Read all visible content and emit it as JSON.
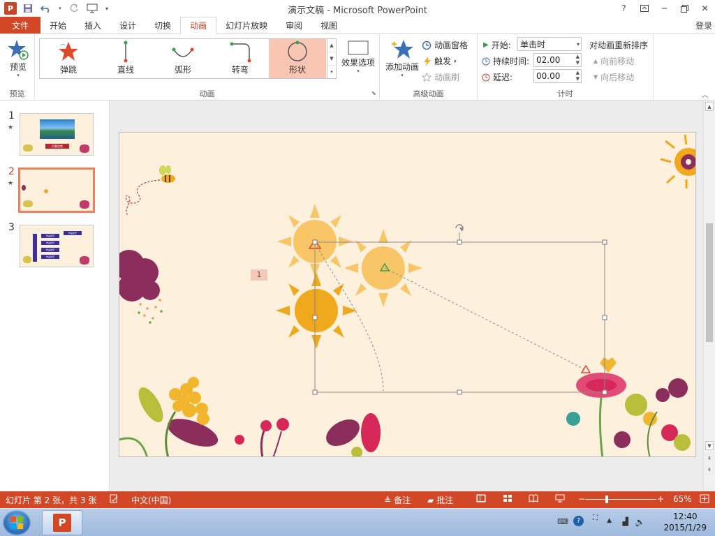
{
  "window": {
    "title": "演示文稿 - Microsoft PowerPoint",
    "login": "登录"
  },
  "tabs": [
    "文件",
    "开始",
    "插入",
    "设计",
    "切换",
    "动画",
    "幻灯片放映",
    "审阅",
    "视图"
  ],
  "active_tab": "动画",
  "ribbon": {
    "preview": {
      "label": "预览",
      "group": "预览"
    },
    "animation_group": "动画",
    "gallery": [
      {
        "label": "弹跳",
        "icon": "bounce-star-icon"
      },
      {
        "label": "直线",
        "icon": "line-path-icon"
      },
      {
        "label": "弧形",
        "icon": "arc-path-icon"
      },
      {
        "label": "转弯",
        "icon": "turn-path-icon"
      },
      {
        "label": "形状",
        "icon": "shape-path-icon"
      }
    ],
    "selected_effect": "形状",
    "effect_options": "效果选项",
    "advanced": {
      "group": "高级动画",
      "add_animation": "添加动画",
      "animation_pane": "动画窗格",
      "trigger": "触发",
      "animation_painter": "动画刷"
    },
    "timing": {
      "group": "计时",
      "start_label": "开始:",
      "start_value": "单击时",
      "duration_label": "持续时间:",
      "duration_value": "02.00",
      "delay_label": "延迟:",
      "delay_value": "00.00",
      "reorder_title": "对动画重新排序",
      "move_earlier": "向前移动",
      "move_later": "向后移动"
    }
  },
  "slides": [
    {
      "num": "1",
      "thumb_title": "风景欣赏"
    },
    {
      "num": "2"
    },
    {
      "num": "3",
      "thumb_items": [
        "作品欣赏",
        "作品欣赏",
        "作品欣赏",
        "作品欣赏",
        "作品欣赏"
      ]
    }
  ],
  "selected_slide": "2",
  "canvas": {
    "animation_tag": "1"
  },
  "status": {
    "slide_info": "幻灯片 第 2 张，共 3 张",
    "language": "中文(中国)",
    "notes": "备注",
    "comments": "批注",
    "zoom": "65%"
  },
  "taskbar": {
    "time": "12:40",
    "date": "2015/1/29"
  },
  "colors": {
    "accent": "#d24726",
    "slide_bg": "#fdf0dc",
    "sun_light": "#f8c567",
    "sun_dark": "#f0a81c"
  }
}
